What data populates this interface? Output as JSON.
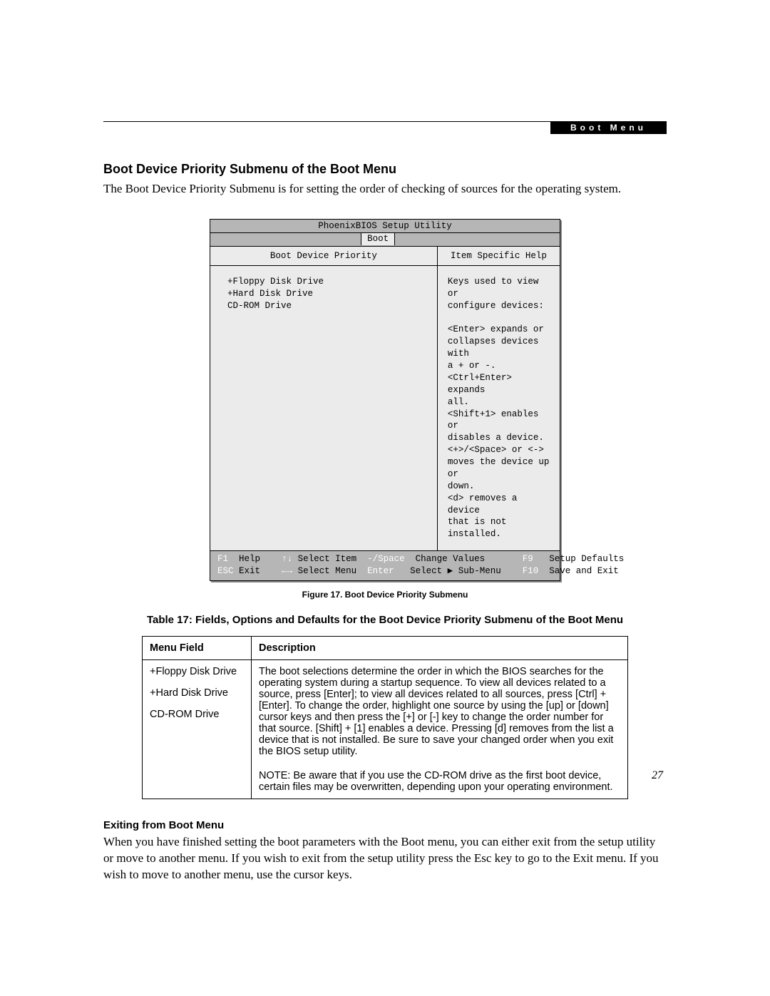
{
  "header_tag": "Boot Menu",
  "heading": "Boot Device Priority Submenu of the Boot Menu",
  "intro_text": "The Boot Device Priority Submenu is for setting the order of checking of sources for the operating system.",
  "bios": {
    "title": "PhoenixBIOS Setup Utility",
    "active_tab": "Boot",
    "left_header": "Boot Device Priority",
    "right_header": "Item Specific Help",
    "devices": [
      "+Floppy Disk Drive",
      "+Hard Disk Drive",
      " CD-ROM Drive"
    ],
    "help_text": "Keys used to view or\nconfigure devices:\n\n<Enter> expands or\ncollapses devices with\na + or -.\n<Ctrl+Enter> expands\nall.\n<Shift+1> enables or\ndisables a device.\n<+>/<Space> or <->\nmoves the device up or\ndown.\n<d> removes a device\nthat is not installed.",
    "footer_keys": {
      "row1": [
        {
          "k": "F1",
          "t": "Help"
        },
        {
          "k": "↑↓",
          "t": "Select Item"
        },
        {
          "k": "-/Space",
          "t": "Change Values"
        },
        {
          "k": "F9",
          "t": "Setup Defaults"
        }
      ],
      "row2": [
        {
          "k": "ESC",
          "t": "Exit"
        },
        {
          "k": "←→",
          "t": "Select Menu"
        },
        {
          "k": "Enter",
          "t": "Select ▶ Sub-Menu"
        },
        {
          "k": "F10",
          "t": "Save and Exit"
        }
      ]
    }
  },
  "figure_caption": "Figure 17.  Boot Device Priority Submenu",
  "table_caption": "Table 17: Fields, Options and Defaults for the Boot Device Priority Submenu of the Boot Menu",
  "table": {
    "col_menu": "Menu Field",
    "col_desc": "Description",
    "menu_items": [
      "+Floppy Disk Drive",
      "+Hard Disk Drive",
      "CD-ROM Drive"
    ],
    "description_main": "The boot selections determine the order in which the BIOS searches for the operating system during a startup sequence. To view all devices related to a source, press [Enter]; to view all devices related to all sources, press [Ctrl] + [Enter]. To change the order, highlight one source by using the [up] or [down] cursor keys and then press the [+] or [-] key to change the order number for that source. [Shift] + [1] enables a device. Pressing [d] removes from the list a device that is not installed. Be sure to save your changed order when you exit the BIOS setup utility.",
    "description_note": "NOTE: Be aware that if you use the CD-ROM drive as the first boot device, certain files may be overwritten, depending upon your operating environment."
  },
  "exit_heading": "Exiting from Boot Menu",
  "exit_text": "When you have finished setting the boot parameters with the Boot menu, you can either exit from the setup utility or move to another menu. If you wish to exit from the setup utility press the Esc key to go to the Exit menu. If you wish to move to another menu, use the cursor keys.",
  "page_number": "27"
}
